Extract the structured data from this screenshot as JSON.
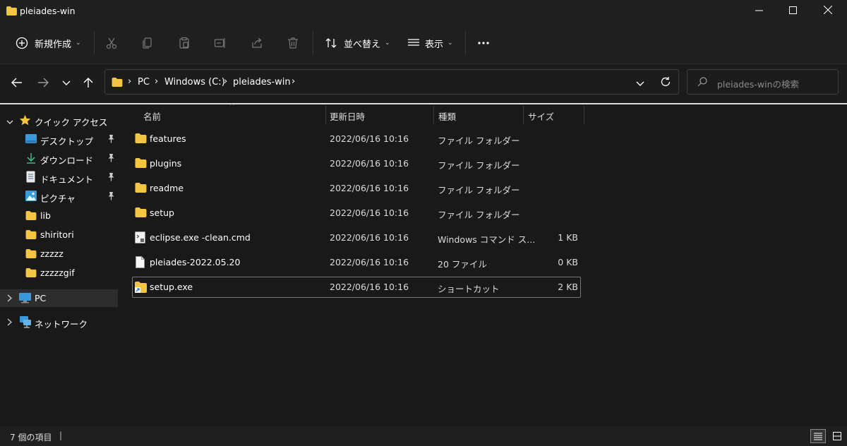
{
  "window": {
    "title": "pleiades-win",
    "icons": [
      "folder-icon",
      "minimize-icon",
      "maximize-icon",
      "close-icon"
    ]
  },
  "toolbar": {
    "new_label": "新規作成",
    "sort_label": "並べ替え",
    "view_label": "表示",
    "icons": [
      "plus-circle-icon",
      "cut-icon",
      "copy-icon",
      "paste-icon",
      "rename-icon",
      "share-icon",
      "delete-icon",
      "sort-icon",
      "view-icon",
      "more-icon"
    ]
  },
  "address": {
    "crumbs": [
      "PC",
      "Windows (C:)",
      "pleiades-win"
    ],
    "search_placeholder": "pleiades-winの検索"
  },
  "nav": {
    "quick_access": "クイック アクセス",
    "items": [
      {
        "label": "デスクトップ",
        "icon": "desktop-icon",
        "pinned": true
      },
      {
        "label": "ダウンロード",
        "icon": "download-icon",
        "pinned": true
      },
      {
        "label": "ドキュメント",
        "icon": "document-icon",
        "pinned": true
      },
      {
        "label": "ピクチャ",
        "icon": "pictures-icon",
        "pinned": true
      },
      {
        "label": "lib",
        "icon": "folder-icon",
        "pinned": false
      },
      {
        "label": "shiritori",
        "icon": "folder-icon",
        "pinned": false
      },
      {
        "label": "zzzzz",
        "icon": "folder-icon",
        "pinned": false
      },
      {
        "label": "zzzzzgif",
        "icon": "folder-icon",
        "pinned": false
      }
    ],
    "pc": "PC",
    "network": "ネットワーク"
  },
  "columns": {
    "name": "名前",
    "date": "更新日時",
    "type": "種類",
    "size": "サイズ"
  },
  "files": [
    {
      "name": "features",
      "date": "2022/06/16 10:16",
      "type": "ファイル フォルダー",
      "size": "",
      "icon": "folder-icon"
    },
    {
      "name": "plugins",
      "date": "2022/06/16 10:16",
      "type": "ファイル フォルダー",
      "size": "",
      "icon": "folder-icon"
    },
    {
      "name": "readme",
      "date": "2022/06/16 10:16",
      "type": "ファイル フォルダー",
      "size": "",
      "icon": "folder-icon"
    },
    {
      "name": "setup",
      "date": "2022/06/16 10:16",
      "type": "ファイル フォルダー",
      "size": "",
      "icon": "folder-icon"
    },
    {
      "name": "eclipse.exe -clean.cmd",
      "date": "2022/06/16 10:16",
      "type": "Windows コマンド ス...",
      "size": "1 KB",
      "icon": "cmd-file-icon"
    },
    {
      "name": "pleiades-2022.05.20",
      "date": "2022/06/16 10:16",
      "type": "20 ファイル",
      "size": "0 KB",
      "icon": "file-icon"
    },
    {
      "name": "setup.exe",
      "date": "2022/06/16 10:16",
      "type": "ショートカット",
      "size": "2 KB",
      "icon": "shortcut-icon"
    }
  ],
  "status": {
    "count": "7 個の項目",
    "icons": [
      "details-view-icon",
      "tiles-view-icon"
    ]
  },
  "colors": {
    "folder": "#f4c542",
    "background": "#191919",
    "selected": "#2d2d2d"
  }
}
